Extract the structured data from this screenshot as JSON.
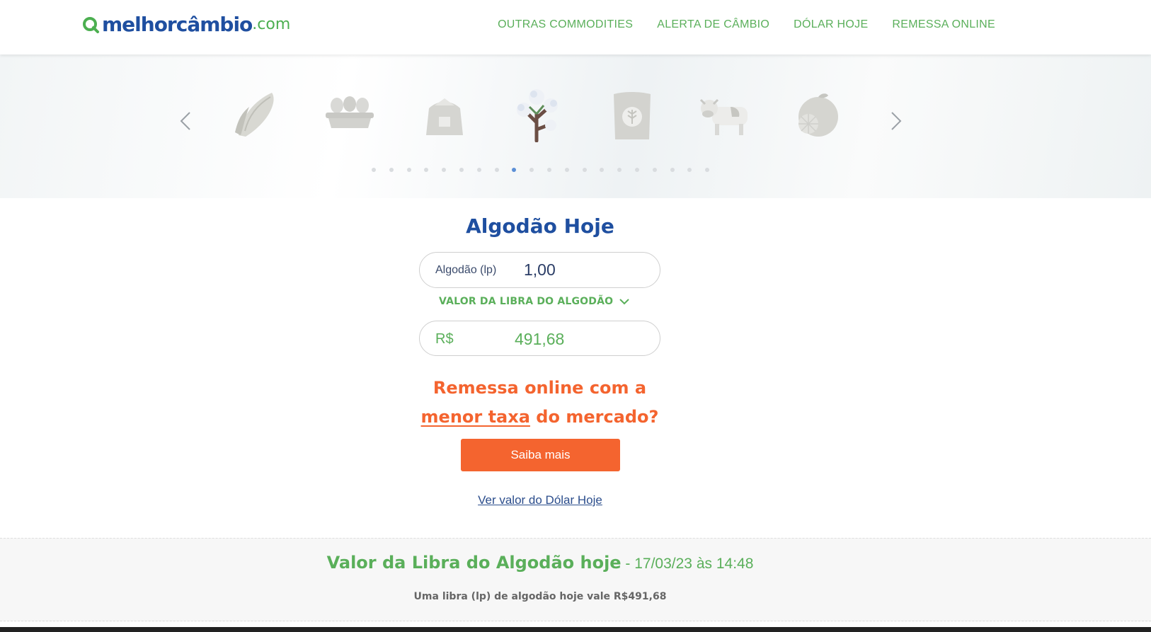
{
  "logo": {
    "brand": "melhorcâmbio",
    "suffix": ".com"
  },
  "nav": [
    "OUTRAS COMMODITIES",
    "ALERTA DE CÂMBIO",
    "DÓLAR HOJE",
    "REMESSA ONLINE"
  ],
  "carousel": {
    "items": [
      "corn-icon",
      "eggs-icon",
      "sugar-sack-icon",
      "cotton-icon",
      "grain-sack-icon",
      "cow-icon",
      "orange-icon"
    ],
    "active_item": "cotton-icon",
    "dot_count": 20,
    "active_dot": 8
  },
  "converter": {
    "title": "Algodão Hoje",
    "from_label": "Algodão (lp)",
    "from_value": "1,00",
    "select_label": "VALOR DA LIBRA DO ALGODÃO",
    "to_label": "R$",
    "to_value": "491,68"
  },
  "promo": {
    "line1": "Remessa online com a",
    "highlight": "menor taxa",
    "line2_rest": " do mercado?",
    "button": "Saiba mais"
  },
  "dollar_link": "Ver valor do Dólar Hoje",
  "info": {
    "title": "Valor da Libra do Algodão hoje",
    "date": " - 17/03/23 às 14:48",
    "subtitle": "Uma libra (lp) de algodão hoje vale R$491,68"
  },
  "colors": {
    "brand_blue": "#1f4fa0",
    "brand_green": "#5aaf5a",
    "accent_orange": "#f4642f"
  }
}
